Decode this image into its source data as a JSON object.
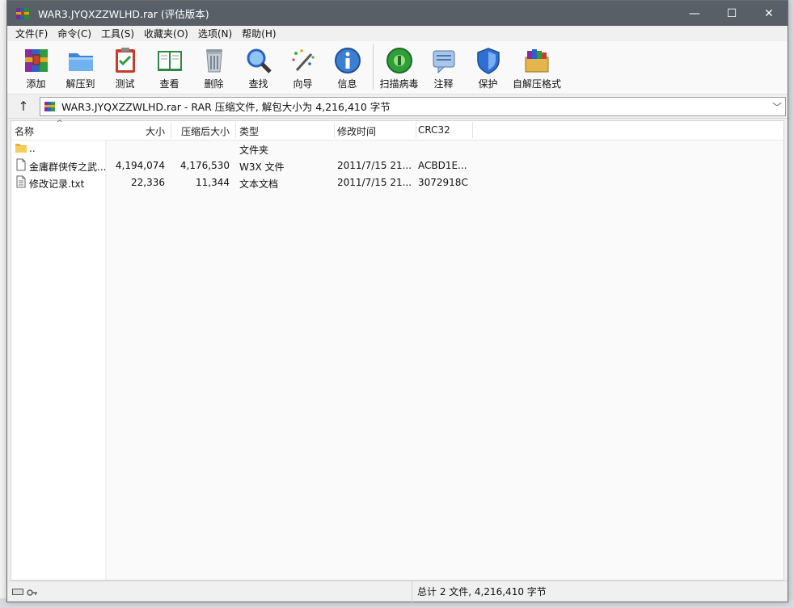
{
  "window": {
    "title": "WAR3.JYQXZZWLHD.rar (评估版本)",
    "controls": {
      "minimize": "—",
      "maximize": "☐",
      "close": "✕"
    }
  },
  "menu": [
    "文件(F)",
    "命令(C)",
    "工具(S)",
    "收藏夹(O)",
    "选项(N)",
    "帮助(H)"
  ],
  "toolbar": {
    "add": "添加",
    "extract_to": "解压到",
    "test": "测试",
    "view": "查看",
    "delete": "删除",
    "find": "查找",
    "wizard": "向导",
    "info": "信息",
    "virus_scan": "扫描病毒",
    "comment": "注释",
    "protect": "保护",
    "sfx": "自解压格式"
  },
  "address": {
    "up": "↑",
    "path": "WAR3.JYQXZZWLHD.rar - RAR 压缩文件, 解包大小为 4,216,410 字节",
    "dropdown": "﹀"
  },
  "columns": {
    "name": "名称",
    "size": "大小",
    "packed": "压缩后大小",
    "type": "类型",
    "modified": "修改时间",
    "crc": "CRC32",
    "sort_caret": "^"
  },
  "files": [
    {
      "name": "..",
      "size": "",
      "packed": "",
      "type": "文件夹",
      "modified": "",
      "crc": "",
      "icon": "folder-icon"
    },
    {
      "name": "金庸群侠传之武...",
      "size": "4,194,074",
      "packed": "4,176,530",
      "type": "W3X 文件",
      "modified": "2011/7/15 21...",
      "crc": "ACBD1E...",
      "icon": "file-icon"
    },
    {
      "name": "修改记录.txt",
      "size": "22,336",
      "packed": "11,344",
      "type": "文本文档",
      "modified": "2011/7/15 21...",
      "crc": "3072918C",
      "icon": "text-file-icon"
    }
  ],
  "status": {
    "summary": "总计 2 文件, 4,216,410 字节"
  },
  "colors": {
    "titlebar": "#585f67",
    "accent_green": "#2e9e3a",
    "accent_blue": "#2f6fd3"
  }
}
